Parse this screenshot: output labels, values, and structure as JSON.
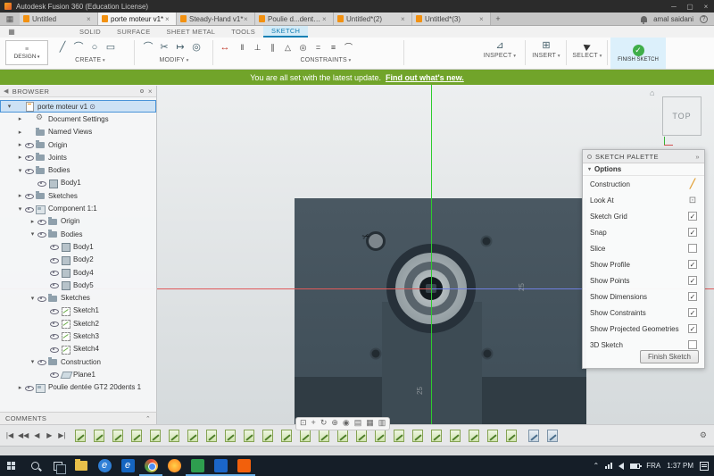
{
  "window": {
    "title": "Autodesk Fusion 360 (Education License)"
  },
  "tabbar": {
    "tabs": [
      {
        "label": "Untitled"
      },
      {
        "label": "porte moteur v1*",
        "active": true
      },
      {
        "label": "Steady-Hand v1*"
      },
      {
        "label": "Poulie d...dents v1*"
      },
      {
        "label": "Untitled*(2)"
      },
      {
        "label": "Untitled*(3)"
      }
    ],
    "user_name": "amal saidani"
  },
  "ribbon": {
    "workspace_label": "DESIGN",
    "tabs": [
      {
        "label": "SOLID"
      },
      {
        "label": "SURFACE"
      },
      {
        "label": "SHEET METAL"
      },
      {
        "label": "TOOLS"
      },
      {
        "label": "SKETCH",
        "active": true
      }
    ],
    "groups": {
      "create": "CREATE",
      "modify": "MODIFY",
      "constraints": "CONSTRAINTS",
      "inspect": "INSPECT",
      "insert": "INSERT",
      "select": "SELECT"
    },
    "finish_label": "FINISH SKETCH",
    "create_icons": [
      {
        "g": "╱",
        "n": "line-tool-icon"
      },
      {
        "g": "⌒",
        "n": "arc-tool-icon"
      },
      {
        "g": "○",
        "n": "circle-tool-icon"
      },
      {
        "g": "▭",
        "n": "rectangle-tool-icon"
      }
    ],
    "modify_icons": [
      {
        "g": "⌒",
        "n": "fillet-tool-icon"
      },
      {
        "g": "✂",
        "n": "trim-tool-icon"
      },
      {
        "g": "↦",
        "n": "extend-tool-icon"
      },
      {
        "g": "◎",
        "n": "offset-tool-icon"
      }
    ],
    "constraint_icons": [
      {
        "g": "‖",
        "n": "vertical-constraint-icon"
      },
      {
        "g": "⊥",
        "n": "perpendicular-constraint-icon"
      },
      {
        "g": "∥",
        "n": "parallel-constraint-icon"
      },
      {
        "g": "△",
        "n": "tangent-constraint-icon"
      },
      {
        "g": "◎",
        "n": "concentric-constraint-icon"
      },
      {
        "g": "=",
        "n": "equal-constraint-icon"
      },
      {
        "g": "≡",
        "n": "symmetry-constraint-icon"
      },
      {
        "g": "⌒",
        "n": "curvature-constraint-icon"
      }
    ],
    "inspect_icon": "⊿",
    "insert_icon": "⊞"
  },
  "notification": {
    "message": "You are all set with the latest update.",
    "link": "Find out what's new."
  },
  "browser": {
    "header": "BROWSER",
    "items": [
      {
        "label": "porte moteur v1",
        "level": 0,
        "arrow": "down",
        "icon": "doc",
        "selected": true
      },
      {
        "label": "Document Settings",
        "level": 1,
        "arrow": "right",
        "icon": "gear"
      },
      {
        "label": "Named Views",
        "level": 1,
        "arrow": "right",
        "icon": "folder"
      },
      {
        "label": "Origin",
        "level": 1,
        "arrow": "right",
        "icon": "folder",
        "eye": true
      },
      {
        "label": "Joints",
        "level": 1,
        "arrow": "right",
        "icon": "folder",
        "eye": true
      },
      {
        "label": "Bodies",
        "level": 1,
        "arrow": "down",
        "icon": "folder",
        "eye": true
      },
      {
        "label": "Body1",
        "level": 2,
        "icon": "body",
        "eye": true
      },
      {
        "label": "Sketches",
        "level": 1,
        "arrow": "right",
        "icon": "folder",
        "eye": true
      },
      {
        "label": "Component 1:1",
        "level": 1,
        "arrow": "down",
        "icon": "component",
        "eye": true
      },
      {
        "label": "Origin",
        "level": 2,
        "arrow": "right",
        "icon": "folder",
        "eye": true
      },
      {
        "label": "Bodies",
        "level": 2,
        "arrow": "down",
        "icon": "folder",
        "eye": true
      },
      {
        "label": "Body1",
        "level": 3,
        "icon": "body",
        "eye": true
      },
      {
        "label": "Body2",
        "level": 3,
        "icon": "body",
        "eye": true
      },
      {
        "label": "Body4",
        "level": 3,
        "icon": "body",
        "eye": true
      },
      {
        "label": "Body5",
        "level": 3,
        "icon": "body",
        "eye": true
      },
      {
        "label": "Sketches",
        "level": 2,
        "arrow": "down",
        "icon": "folder",
        "eye": true
      },
      {
        "label": "Sketch1",
        "level": 3,
        "icon": "sketch",
        "eye": true
      },
      {
        "label": "Sketch2",
        "level": 3,
        "icon": "sketch",
        "eye": true
      },
      {
        "label": "Sketch3",
        "level": 3,
        "icon": "sketch",
        "eye": true
      },
      {
        "label": "Sketch4",
        "level": 3,
        "icon": "sketch",
        "eye": true
      },
      {
        "label": "Construction",
        "level": 2,
        "arrow": "down",
        "icon": "folder",
        "eye": true
      },
      {
        "label": "Plane1",
        "level": 3,
        "icon": "plane",
        "eye": true
      },
      {
        "label": "Poulie dentée GT2 20dents 1",
        "level": 1,
        "arrow": "right",
        "icon": "component",
        "eye": true
      }
    ]
  },
  "comments": {
    "label": "COMMENTS"
  },
  "viewport": {
    "viewcube_face": "TOP",
    "dim_right": "25",
    "dim_bottom": "25"
  },
  "viewnav_icons": [
    {
      "g": "⊡",
      "n": "fit-view-icon"
    },
    {
      "g": "+",
      "n": "pan-icon"
    },
    {
      "g": "↻",
      "n": "orbit-icon"
    },
    {
      "g": "⊕",
      "n": "zoom-icon"
    },
    {
      "g": "◉",
      "n": "look-at-icon"
    },
    {
      "g": "▤",
      "n": "display-settings-icon",
      "caret": true
    },
    {
      "g": "▦",
      "n": "grid-settings-icon",
      "caret": true
    },
    {
      "g": "▥",
      "n": "viewports-icon",
      "caret": true
    }
  ],
  "playback": [
    {
      "g": "|◀",
      "n": "go-to-start-icon"
    },
    {
      "g": "◀◀",
      "n": "step-back-all-icon"
    },
    {
      "g": "◀",
      "n": "step-back-icon"
    },
    {
      "g": "▶",
      "n": "play-icon"
    },
    {
      "g": "▶|",
      "n": "go-to-end-icon"
    }
  ],
  "timeline": {
    "sketch_count": 24,
    "aux_count": 2
  },
  "sketch_palette": {
    "title": "SKETCH PALETTE",
    "section": "Options",
    "items": [
      {
        "label": "Construction",
        "control": "slash"
      },
      {
        "label": "Look At",
        "control": "lookat"
      },
      {
        "label": "Sketch Grid",
        "control": "check",
        "checked": true
      },
      {
        "label": "Snap",
        "control": "check",
        "checked": true
      },
      {
        "label": "Slice",
        "control": "check",
        "checked": false
      },
      {
        "label": "Show Profile",
        "control": "check",
        "checked": true
      },
      {
        "label": "Show Points",
        "control": "check",
        "checked": true
      },
      {
        "label": "Show Dimensions",
        "control": "check",
        "checked": true
      },
      {
        "label": "Show Constraints",
        "control": "check",
        "checked": true
      },
      {
        "label": "Show Projected Geometries",
        "control": "check",
        "checked": true
      },
      {
        "label": "3D Sketch",
        "control": "check",
        "checked": false
      }
    ],
    "finish_button": "Finish Sketch"
  },
  "taskbar": {
    "language": "FRA",
    "time": "1:37 PM"
  },
  "colors": {
    "notification_green": "#71a42a",
    "selection_blue": "#4a94d8",
    "finish_check_green": "#3fae49",
    "sketch_tab_blue": "#1780b4"
  }
}
